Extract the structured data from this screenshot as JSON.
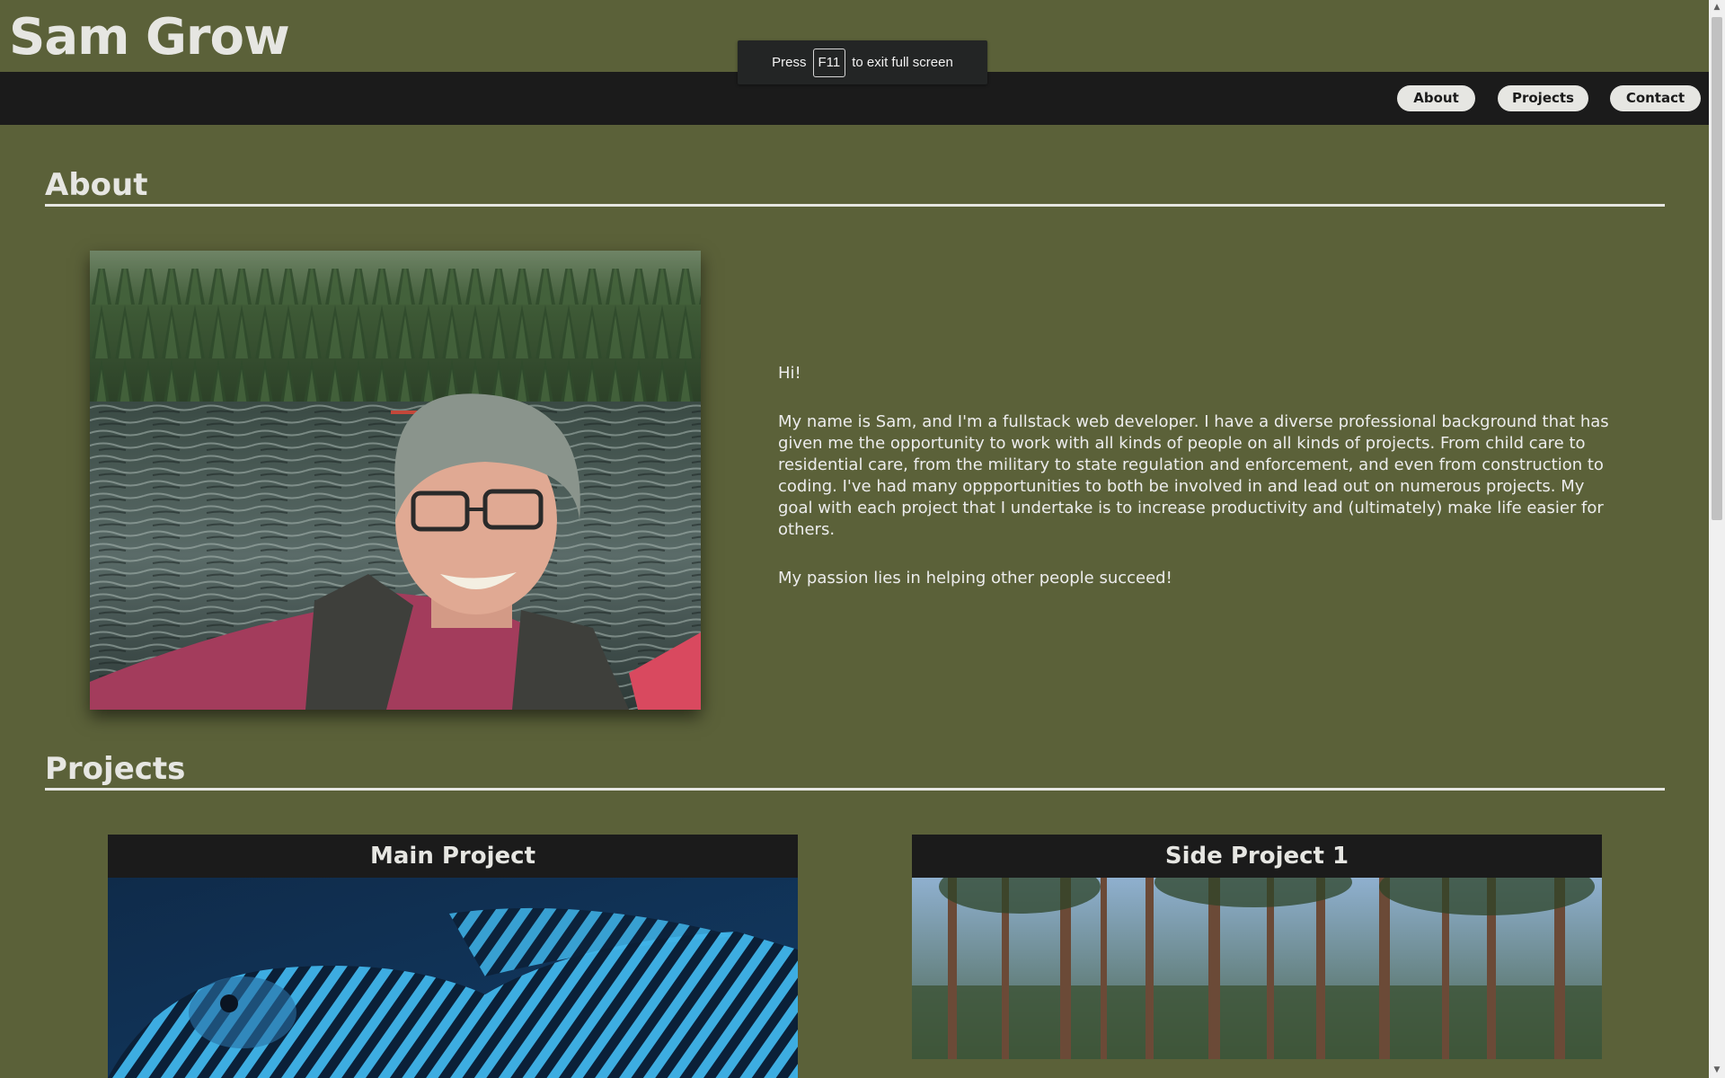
{
  "header": {
    "site_title": "Sam Grow"
  },
  "nav": {
    "items": [
      {
        "label": "About"
      },
      {
        "label": "Projects"
      },
      {
        "label": "Contact"
      }
    ]
  },
  "fullscreen_toast": {
    "prefix": "Press",
    "key": "F11",
    "suffix": "to exit full screen"
  },
  "about": {
    "heading": "About",
    "paragraphs": [
      "Hi!",
      "My name is Sam, and I'm a fullstack web developer. I have a diverse professional background that has given me the opportunity to work with all kinds of people on all kinds of projects. From child care to residential care, from the military to state regulation and enforcement, and even from construction to coding. I've had many oppportunities to both be involved in and lead out on numerous projects. My goal with each project that I undertake is to increase productivity and (ultimately) make life easier for others.",
      "My passion lies in helping other people succeed!"
    ]
  },
  "projects": {
    "heading": "Projects",
    "cards": [
      {
        "title": "Main Project"
      },
      {
        "title": "Side Project 1"
      }
    ]
  },
  "colors": {
    "page_background": "#5b6139",
    "navbar_background": "#1b1b1b",
    "heading_text": "#e6e6e2",
    "nav_button_background": "#e6e6e2"
  }
}
